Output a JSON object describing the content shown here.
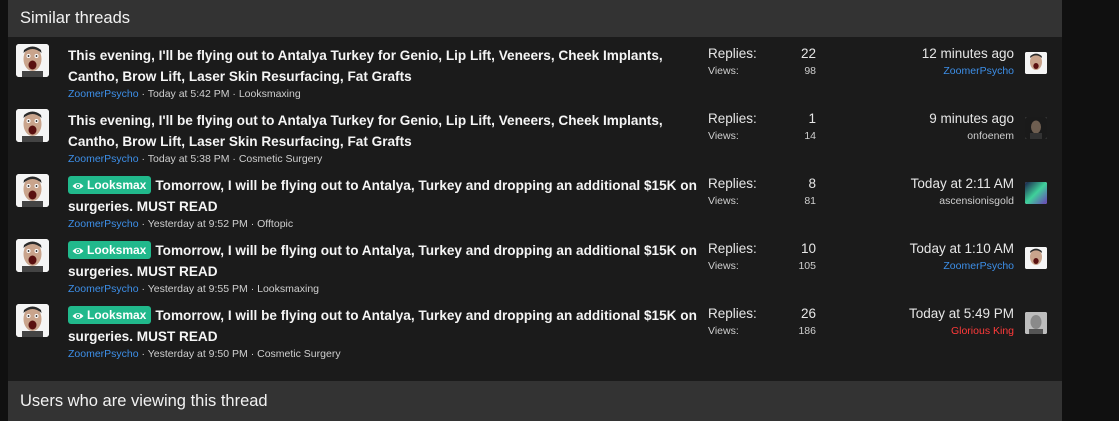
{
  "header": {
    "title": "Similar threads"
  },
  "footer": {
    "title": "Users who are viewing this thread"
  },
  "labels": {
    "replies": "Replies:",
    "views": "Views:"
  },
  "threads": [
    {
      "prefix": "",
      "title": "This evening, I'll be flying out to Antalya Turkey for Genio, Lip Lift, Veneers, Cheek Implants, Cantho, Brow Lift, Laser Skin Resurfacing, Fat Grafts",
      "author": "ZoomerPsycho",
      "date": "Today at 5:42 PM",
      "forum": "Looksmaxing",
      "replies": "22",
      "views": "98",
      "last_time": "12 minutes ago",
      "last_user": "ZoomerPsycho"
    },
    {
      "prefix": "",
      "title": "This evening, I'll be flying out to Antalya Turkey for Genio, Lip Lift, Veneers, Cheek Implants, Cantho, Brow Lift, Laser Skin Resurfacing, Fat Grafts",
      "author": "ZoomerPsycho",
      "date": "Today at 5:38 PM",
      "forum": "Cosmetic Surgery",
      "replies": "1",
      "views": "14",
      "last_time": "9 minutes ago",
      "last_user": "onfoenem"
    },
    {
      "prefix": "Looksmax",
      "title": "Tomorrow, I will be flying out to Antalya, Turkey and dropping an additional $15K on surgeries. MUST READ",
      "author": "ZoomerPsycho",
      "date": "Yesterday at 9:52 PM",
      "forum": "Offtopic",
      "replies": "8",
      "views": "81",
      "last_time": "Today at 2:11 AM",
      "last_user": "ascensionisgold"
    },
    {
      "prefix": "Looksmax",
      "title": "Tomorrow, I will be flying out to Antalya, Turkey and dropping an additional $15K on surgeries. MUST READ",
      "author": "ZoomerPsycho",
      "date": "Yesterday at 9:55 PM",
      "forum": "Looksmaxing",
      "replies": "10",
      "views": "105",
      "last_time": "Today at 1:10 AM",
      "last_user": "ZoomerPsycho"
    },
    {
      "prefix": "Looksmax",
      "title": "Tomorrow, I will be flying out to Antalya, Turkey and dropping an additional $15K on surgeries. MUST READ",
      "author": "ZoomerPsycho",
      "date": "Yesterday at 9:50 PM",
      "forum": "Cosmetic Surgery",
      "replies": "26",
      "views": "186",
      "last_time": "Today at 5:49 PM",
      "last_user": "Glorious King"
    }
  ],
  "colors": {
    "prefix_bg": "#21b98c",
    "username_blue": "#3d8fe8",
    "username_red": "#ff3a3a",
    "header_bg": "#333333",
    "panel_bg": "#1b1b1b"
  },
  "icons": {
    "prefix_icon": "eye-icon",
    "avatar_author": "screaming-face-avatar",
    "avatar_last_user_2": "dark-face-avatar",
    "avatar_last_user_3": "aurora-avatar",
    "avatar_last_user_5": "gray-face-avatar"
  }
}
